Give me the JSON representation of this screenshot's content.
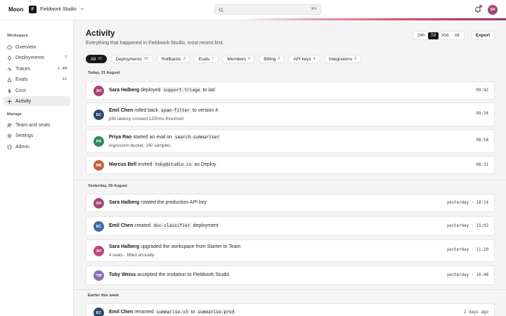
{
  "app": {
    "name": "Moon"
  },
  "workspace": {
    "logo_letter": "F",
    "name": "Fieldwork Studio"
  },
  "search": {
    "placeholder": "",
    "shortcut": "⌘K"
  },
  "user": {
    "initials": "SH"
  },
  "colors": {
    "accent": "#d04a5e",
    "active_dark": "#18181b"
  },
  "sidebar": {
    "workspace_label": "Workspace",
    "manage_label": "Manage",
    "items": [
      {
        "label": "Overview",
        "icon": "circle-icon",
        "badge": ""
      },
      {
        "label": "Deployments",
        "icon": "rocket-icon",
        "badge": "7"
      },
      {
        "label": "Traces",
        "icon": "trace-icon",
        "badge": "2.4M"
      },
      {
        "label": "Evals",
        "icon": "flask-icon",
        "badge": "12"
      },
      {
        "label": "Cost",
        "icon": "dollar-icon",
        "badge": ""
      },
      {
        "label": "Activity",
        "icon": "activity-icon",
        "badge": ""
      },
      {
        "label": "Team and seats",
        "icon": "users-icon",
        "badge": ""
      },
      {
        "label": "Settings",
        "icon": "gear-icon",
        "badge": ""
      },
      {
        "label": "Admin",
        "icon": "shield-icon",
        "badge": ""
      }
    ]
  },
  "header": {
    "title": "Activity",
    "subtitle": "Everything that happened in Fieldwork Studio, most recent first.",
    "ranges": [
      "24h",
      "7d",
      "30d",
      "All"
    ],
    "active_range": "7d",
    "export_label": "Export"
  },
  "filters": [
    {
      "label": "All",
      "count": "42"
    },
    {
      "label": "Deployments",
      "count": "18"
    },
    {
      "label": "Rollbacks",
      "count": "3"
    },
    {
      "label": "Evals",
      "count": "7"
    },
    {
      "label": "Members",
      "count": "6"
    },
    {
      "label": "Billing",
      "count": "2"
    },
    {
      "label": "API keys",
      "count": "4"
    },
    {
      "label": "Integrations",
      "count": "2"
    }
  ],
  "groups": [
    {
      "label": "Today, 21 August"
    },
    {
      "label": "Yesterday, 20 August"
    },
    {
      "label": "Earlier this week"
    }
  ],
  "events": [
    {
      "initials": "SH",
      "color": "#a8446f",
      "actor": "Sara Halberg",
      "pre": "deployed",
      "code1": "support-triage",
      "mid": "to iad",
      "code2": "",
      "post": "",
      "meta": "",
      "time": "09:42"
    },
    {
      "initials": "EC",
      "color": "#2c4a6e",
      "actor": "Emil Chen",
      "pre": "rolled back",
      "code1": "spam-filter",
      "mid": "to version 4",
      "code2": "",
      "post": "",
      "meta": "p95 latency crossed 1200ms threshold",
      "time": "09:24"
    },
    {
      "initials": "PR",
      "color": "#2f8a5c",
      "actor": "Priya Rao",
      "pre": "started an eval on",
      "code1": "search-summariser",
      "mid": "",
      "code2": "",
      "post": "",
      "meta": "regression bucket, 240 samples",
      "time": "08:58"
    },
    {
      "initials": "MB",
      "color": "#c0623c",
      "actor": "Marcus Bell",
      "pre": "invited",
      "code1": "toby@studio.co",
      "mid": "as Deploy",
      "code2": "",
      "post": "",
      "meta": "",
      "time": "08:31"
    },
    {
      "initials": "SH",
      "color": "#a8446f",
      "actor": "Sara Halberg",
      "pre": "rotated the production API key",
      "code1": "",
      "mid": "",
      "code2": "",
      "post": "",
      "meta": "",
      "time": "yesterday · 18:14"
    },
    {
      "initials": "EC",
      "color": "#3f6aa8",
      "actor": "Emil Chen",
      "pre": "created",
      "code1": "doc-classifier",
      "mid": "deployment",
      "code2": "",
      "post": "",
      "meta": "",
      "time": "yesterday · 15:02"
    },
    {
      "initials": "SH",
      "color": "#c2457a",
      "actor": "Sara Halberg",
      "pre": "upgraded the workspace from Starter to Team",
      "code1": "",
      "mid": "",
      "code2": "",
      "post": "",
      "meta": "4 seats · billed annually",
      "time": "yesterday · 11:20"
    },
    {
      "initials": "TW",
      "color": "#8a72b8",
      "actor": "Toby Weiss",
      "pre": "accepted the invitation to Fieldwork Studio",
      "code1": "",
      "mid": "",
      "code2": "",
      "post": "",
      "meta": "",
      "time": "yesterday · 10:48"
    },
    {
      "initials": "EC",
      "color": "#2c4a6e",
      "actor": "Emil Chen",
      "pre": "renamed",
      "code1": "summarise-v3",
      "mid": "to",
      "code2": "summarise-prod",
      "post": "",
      "meta": "",
      "time": "2 days ago"
    }
  ]
}
